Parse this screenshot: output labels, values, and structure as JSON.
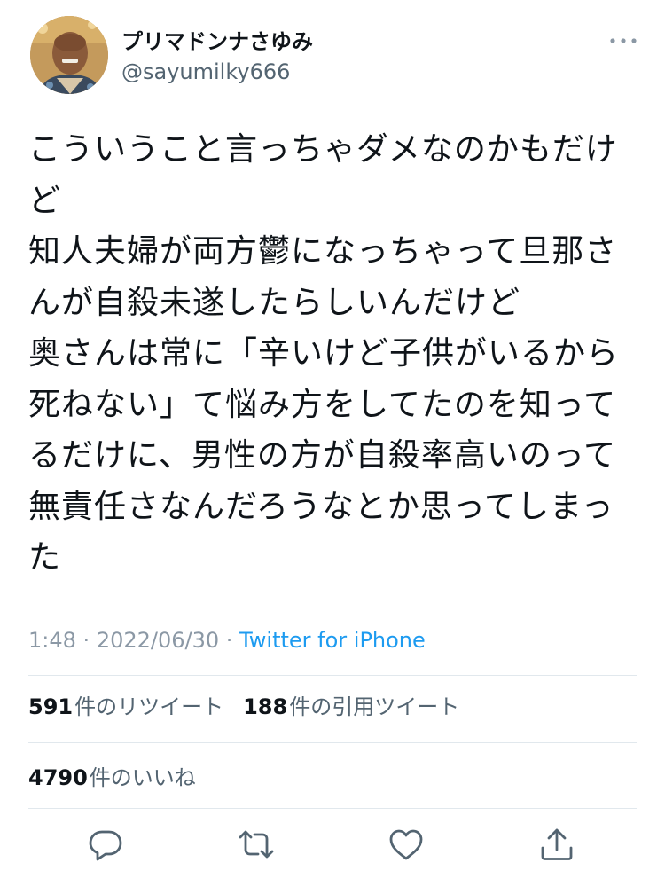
{
  "user": {
    "display_name": "プリマドンナさゆみ",
    "handle": "@sayumilky666"
  },
  "tweet": {
    "lines": [
      "こういうこと言っちゃダメなのかもだけ",
      "ど",
      "知人夫婦が両方鬱になっちゃって旦那さ",
      "んが自殺未遂したらしいんだけど",
      "奥さんは常に「辛いけど子供がいるから",
      "死ねない」て悩み方をしてたのを知って",
      "るだけに、男性の方が自殺率高いのって",
      "無責任さなんだろうなとか思ってしまっ",
      "た"
    ]
  },
  "meta": {
    "time": "1:48",
    "separator": "·",
    "date": "2022/06/30",
    "source": "Twitter for iPhone"
  },
  "stats": {
    "retweets_count": "591",
    "retweets_label": "件のリツイート",
    "quotes_count": "188",
    "quotes_label": "件の引用ツイート",
    "likes_count": "4790",
    "likes_label": "件のいいね"
  },
  "icons": {
    "more": "more-dots-icon",
    "reply": "reply-bubble-icon",
    "retweet": "retweet-arrows-icon",
    "like": "heart-icon",
    "share": "share-upload-icon"
  },
  "colors": {
    "text": "#0f1419",
    "secondary": "#536471",
    "meta": "#8b98a5",
    "link": "#1d9bf0",
    "divider": "#e1e8ed",
    "icon": "#536471"
  }
}
